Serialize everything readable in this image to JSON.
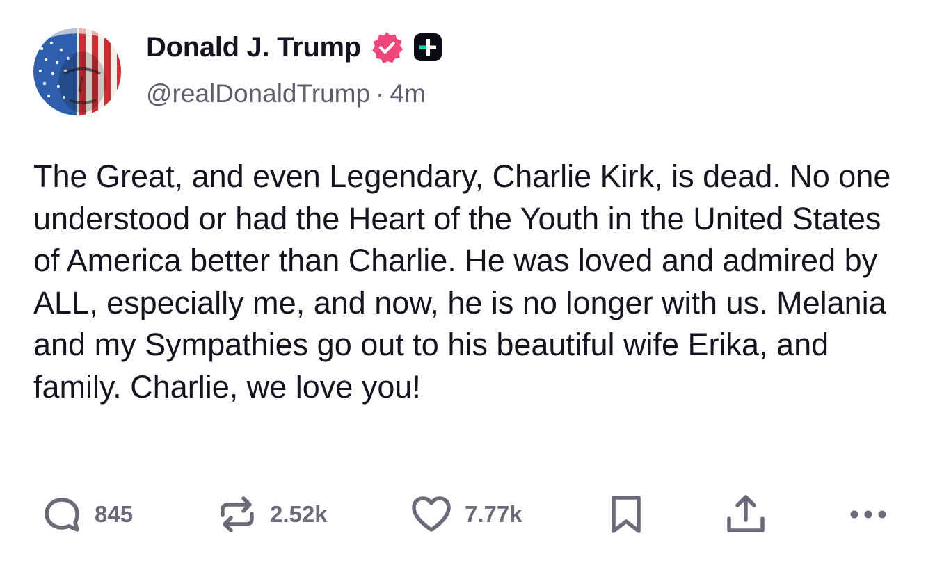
{
  "author": {
    "display_name": "Donald J. Trump",
    "handle": "@realDonaldTrump",
    "separator": "·",
    "time_ago": "4m",
    "verified_color": "#f0457a",
    "plus_badge_color": "#1ad6b2"
  },
  "post": {
    "text": "The Great, and even Legendary, Charlie Kirk, is dead. No one understood or had the Heart of the Youth in the United States of America better than Charlie. He was loved and admired by ALL, especially me, and now, he is no longer with us. Melania and my Sympathies go out to his beautiful wife Erika, and family. Charlie, we love you!"
  },
  "actions": {
    "replies": "845",
    "retruths": "2.52k",
    "likes": "7.77k",
    "icon_color": "#6b6a78"
  }
}
